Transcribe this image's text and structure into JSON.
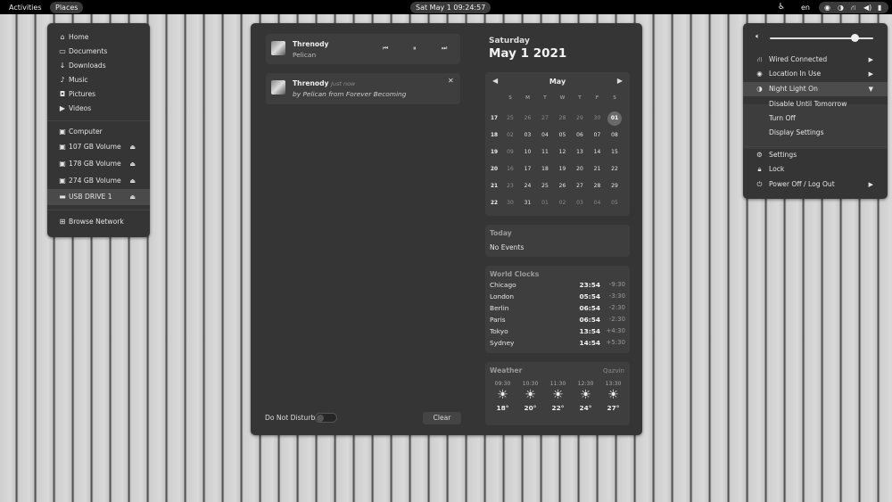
{
  "topbar": {
    "activities": "Activities",
    "places": "Places",
    "datetime": "Sat May 1  09:24:57",
    "lang": "en"
  },
  "places": {
    "items": [
      {
        "label": "Home",
        "icon": "home-icon"
      },
      {
        "label": "Documents",
        "icon": "document-icon"
      },
      {
        "label": "Downloads",
        "icon": "download-icon"
      },
      {
        "label": "Music",
        "icon": "music-icon"
      },
      {
        "label": "Pictures",
        "icon": "camera-icon"
      },
      {
        "label": "Videos",
        "icon": "video-icon"
      }
    ],
    "devices": [
      {
        "label": "Computer"
      },
      {
        "label": "107 GB Volume"
      },
      {
        "label": "178 GB Volume"
      },
      {
        "label": "274 GB Volume"
      },
      {
        "label": "USB DRIVE 1"
      }
    ],
    "network": "Browse Network"
  },
  "media": {
    "title": "Threnody",
    "artist": "Pelican"
  },
  "notification": {
    "title": "Threnody",
    "time": "Just now",
    "by": "by",
    "artist": "Pelican",
    "from": "from",
    "album": "Forever Becoming"
  },
  "dnd_label": "Do Not Disturb",
  "clear_label": "Clear",
  "calendar": {
    "dayname": "Saturday",
    "date": "May 1 2021",
    "month": "May",
    "weekdays": [
      "S",
      "M",
      "T",
      "W",
      "T",
      "F",
      "S"
    ],
    "weeks": [
      "17",
      "18",
      "19",
      "20",
      "21",
      "22"
    ],
    "rows": [
      [
        "25",
        "26",
        "27",
        "28",
        "29",
        "30",
        "01"
      ],
      [
        "02",
        "03",
        "04",
        "05",
        "06",
        "07",
        "08"
      ],
      [
        "09",
        "10",
        "11",
        "12",
        "13",
        "14",
        "15"
      ],
      [
        "16",
        "17",
        "18",
        "19",
        "20",
        "21",
        "22"
      ],
      [
        "23",
        "24",
        "25",
        "26",
        "27",
        "28",
        "29"
      ],
      [
        "30",
        "31",
        "01",
        "02",
        "03",
        "04",
        "05"
      ]
    ]
  },
  "events": {
    "title": "Today",
    "text": "No Events"
  },
  "world_clocks": {
    "title": "World Clocks",
    "items": [
      {
        "city": "Chicago",
        "time": "23:54",
        "offset": "-9:30"
      },
      {
        "city": "London",
        "time": "05:54",
        "offset": "-3:30"
      },
      {
        "city": "Berlin",
        "time": "06:54",
        "offset": "-2:30"
      },
      {
        "city": "Paris",
        "time": "06:54",
        "offset": "-2:30"
      },
      {
        "city": "Tokyo",
        "time": "13:54",
        "offset": "+4:30"
      },
      {
        "city": "Sydney",
        "time": "14:54",
        "offset": "+5:30"
      }
    ]
  },
  "weather": {
    "title": "Weather",
    "location": "Qazvin",
    "forecast": [
      {
        "time": "09:30",
        "temp": "18°"
      },
      {
        "time": "10:30",
        "temp": "20°"
      },
      {
        "time": "11:30",
        "temp": "22°"
      },
      {
        "time": "12:30",
        "temp": "24°"
      },
      {
        "time": "13:30",
        "temp": "27°"
      }
    ]
  },
  "quick_settings": {
    "volume": 0.82,
    "wired": "Wired Connected",
    "location": "Location In Use",
    "night_light": "Night Light On",
    "night_sub": [
      "Disable Until Tomorrow",
      "Turn Off",
      "Display Settings"
    ],
    "settings": "Settings",
    "lock": "Lock",
    "power": "Power Off / Log Out"
  }
}
